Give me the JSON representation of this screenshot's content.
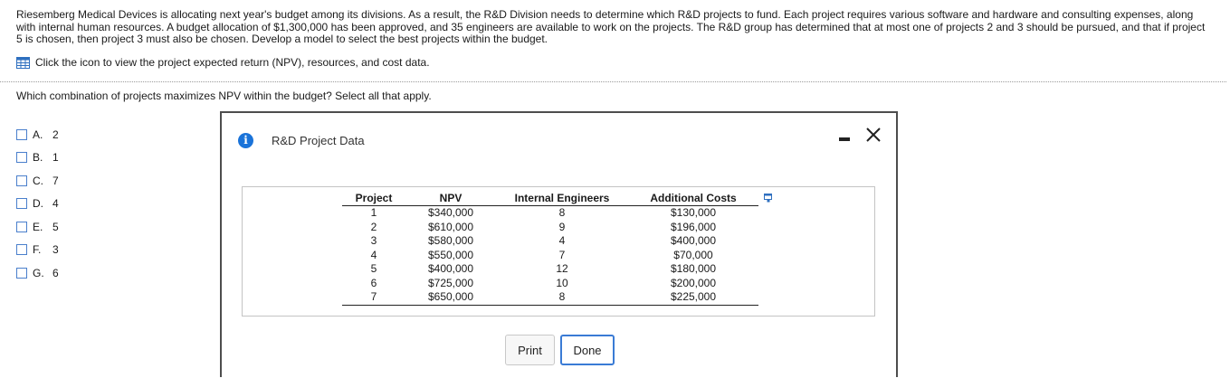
{
  "problem": {
    "text": "Riesemberg Medical Devices is allocating next year's budget among its divisions. As a result, the R&D Division needs to determine which R&D projects to fund. Each project requires various software and hardware and consulting expenses, along with internal human resources. A budget allocation of $1,300,000 has been approved, and 35 engineers are available to work on the projects. The R&D group has determined that at most one of projects 2 and 3 should be pursued, and that if project 5 is chosen, then project 3 must also be chosen. Develop a model to select the best projects within the budget.",
    "icon_link_text": "Click the icon to view the project expected return (NPV), resources, and cost data."
  },
  "question": "Which combination of projects maximizes NPV within the budget? Select all that apply.",
  "choices": [
    {
      "letter": "A.",
      "value": "2"
    },
    {
      "letter": "B.",
      "value": "1"
    },
    {
      "letter": "C.",
      "value": "7"
    },
    {
      "letter": "D.",
      "value": "4"
    },
    {
      "letter": "E.",
      "value": "5"
    },
    {
      "letter": "F.",
      "value": "3"
    },
    {
      "letter": "G.",
      "value": "6"
    }
  ],
  "dialog": {
    "title": "R&D Project Data",
    "headers": [
      "Project",
      "NPV",
      "Internal Engineers",
      "Additional Costs"
    ],
    "rows": [
      [
        "1",
        "$340,000",
        "8",
        "$130,000"
      ],
      [
        "2",
        "$610,000",
        "9",
        "$196,000"
      ],
      [
        "3",
        "$580,000",
        "4",
        "$400,000"
      ],
      [
        "4",
        "$550,000",
        "7",
        "$70,000"
      ],
      [
        "5",
        "$400,000",
        "12",
        "$180,000"
      ],
      [
        "6",
        "$725,000",
        "10",
        "$200,000"
      ],
      [
        "7",
        "$650,000",
        "8",
        "$225,000"
      ]
    ],
    "print_label": "Print",
    "done_label": "Done"
  },
  "colors": {
    "accent": "#1a73d9",
    "checkbox_border": "#4a7fcc",
    "dialog_border": "#4d4d4d"
  },
  "icons": {
    "data_table": "grid-icon",
    "info": "info-icon",
    "minimize": "minimize-icon",
    "close": "close-icon",
    "copy": "copy-icon"
  }
}
